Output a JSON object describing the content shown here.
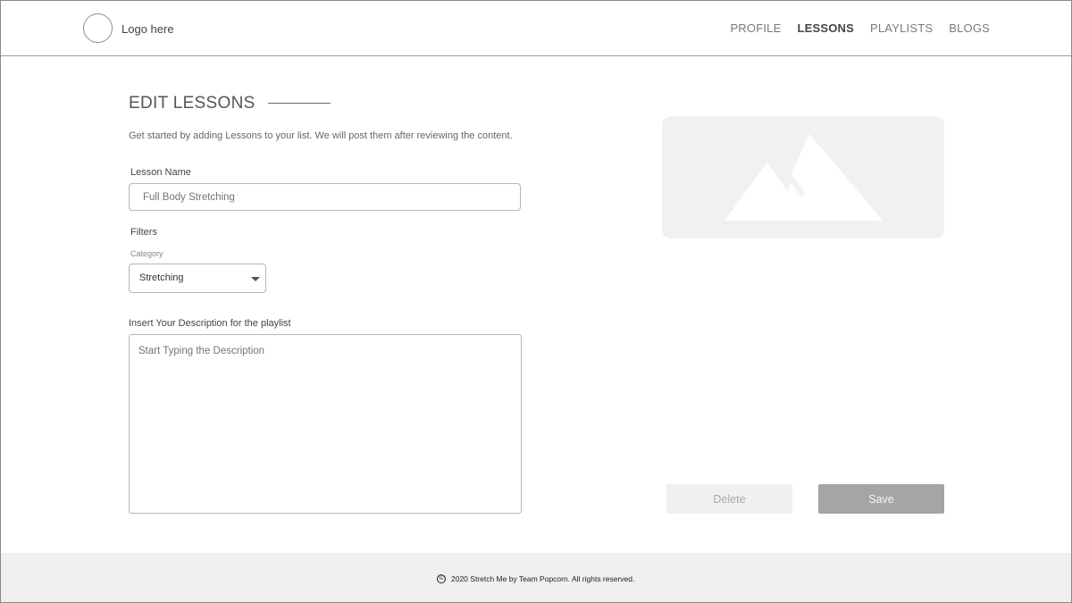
{
  "header": {
    "logo_text": "Logo here",
    "nav": [
      {
        "label": "PROFILE",
        "active": false
      },
      {
        "label": "LESSONS",
        "active": true
      },
      {
        "label": "PLAYLISTS",
        "active": false
      },
      {
        "label": "BLOGS",
        "active": false
      }
    ]
  },
  "main": {
    "title": "EDIT LESSONS",
    "subtitle": "Get started by adding Lessons to your list. We will post them after reviewing the content.",
    "lesson_name": {
      "label": "Lesson Name",
      "placeholder": "Full Body Stretching"
    },
    "filters": {
      "label": "Filters",
      "category_label": "Category",
      "category_value": "Stretching"
    },
    "description": {
      "label": "Insert Your Description for the playlist",
      "placeholder": "Start Typing the Description"
    },
    "image": {
      "icon": "image-placeholder-icon"
    },
    "buttons": {
      "delete_label": "Delete",
      "save_label": "Save"
    }
  },
  "footer": {
    "copyright_symbol": "©",
    "text": "2020 Stretch Me by Team Popcorn. All rights reserved."
  },
  "colors": {
    "save_bg": "#a5a5a5",
    "delete_bg": "#f0f0f0",
    "footer_bg": "#efefef",
    "placeholder_bg": "#f1f1f1"
  }
}
